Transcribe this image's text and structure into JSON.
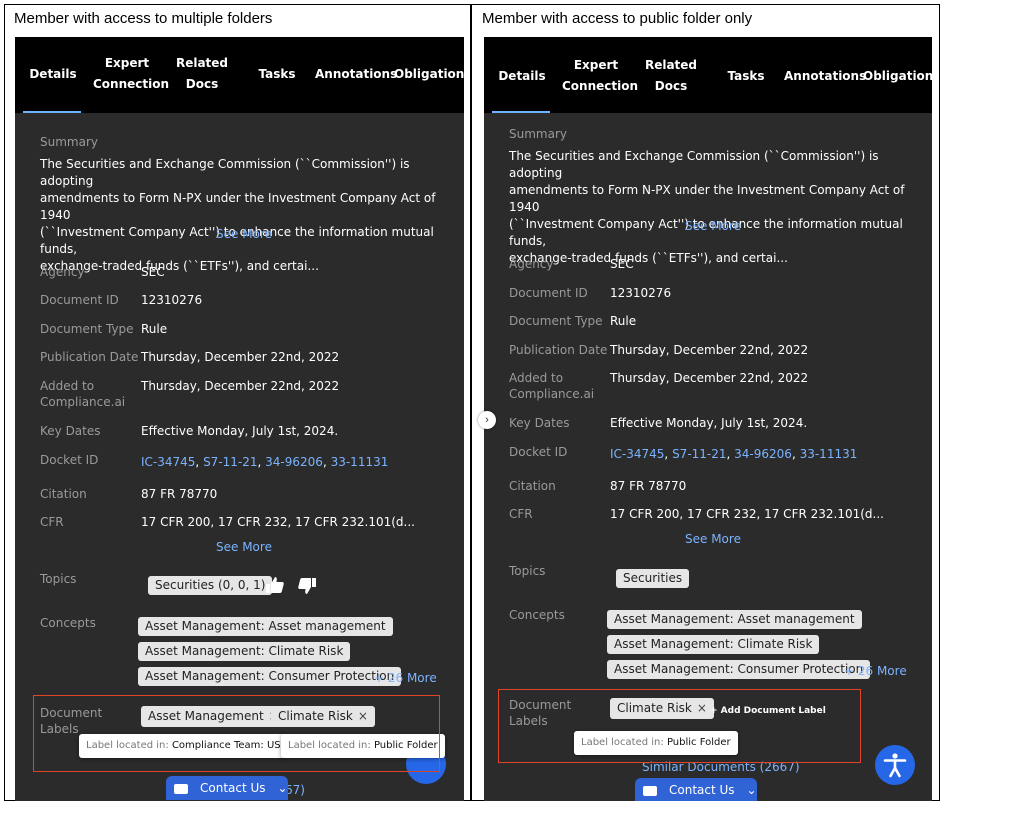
{
  "left": {
    "caption": "Member with access to multiple folders",
    "tabs": {
      "details": "Details",
      "expert_1": "Expert",
      "expert_2": "Connection",
      "related_1": "Related",
      "related_2": "Docs",
      "tasks": "Tasks",
      "annotations": "Annotations",
      "obligations": "Obligations"
    },
    "summary_label": "Summary",
    "summary_lines": [
      "The Securities and Exchange Commission (``Commission'') is adopting",
      "amendments to Form N-PX under the Investment Company Act of 1940",
      "(``Investment Company Act'') to enhance the information mutual funds,",
      "exchange-traded funds (``ETFs''), and certai..."
    ],
    "see_more_1": "See More",
    "fields": {
      "agency_label": "Agency",
      "agency": "SEC",
      "docid_label": "Document ID",
      "docid": "12310276",
      "doctype_label": "Document Type",
      "doctype": "Rule",
      "pubdate_label": "Publication Date",
      "pubdate": "Thursday, December 22nd, 2022",
      "added_label_1": "Added to",
      "added_label_2": "Compliance.ai",
      "added": "Thursday, December 22nd, 2022",
      "keydates_label": "Key Dates",
      "keydates": "Effective Monday, July 1st, 2024.",
      "docket_label": "Docket ID",
      "docket_1": "IC-34745",
      "docket_2": "S7-11-21",
      "docket_3": "34-96206",
      "docket_4": "33-11131",
      "sep": ", ",
      "citation_label": "Citation",
      "citation": "87 FR 78770",
      "cfr_label": "CFR",
      "cfr": "17 CFR 200, 17 CFR 232, 17 CFR 232.101(d..."
    },
    "see_more_2": "See More",
    "topics_label": "Topics",
    "topic_chip": "Securities (0, 0, 1)",
    "concepts_label": "Concepts",
    "concepts": [
      "Asset Management: Asset management",
      "Asset Management: Climate Risk",
      "Asset Management: Consumer Protection"
    ],
    "more_concepts": "+ 26 More",
    "doc_labels_1": "Document",
    "doc_labels_2": "Labels",
    "label_chips": [
      "Asset Management",
      "Climate Risk"
    ],
    "chip_close": "×",
    "tooltip_prefix": "Label located in:",
    "tooltip_1": "Compliance Team: US",
    "tooltip_2": "Public Folder",
    "similar_partial": "67)",
    "contact": "Contact Us"
  },
  "right": {
    "caption": "Member with access to public folder only",
    "tabs": {
      "details": "Details",
      "expert_1": "Expert",
      "expert_2": "Connection",
      "related_1": "Related",
      "related_2": "Docs",
      "tasks": "Tasks",
      "annotations": "Annotations",
      "obligations": "Obligations"
    },
    "summary_label": "Summary",
    "summary_lines": [
      "The Securities and Exchange Commission (``Commission'') is adopting",
      "amendments to Form N-PX under the Investment Company Act of 1940",
      "(``Investment Company Act'') to enhance the information mutual funds,",
      "exchange-traded funds (``ETFs''), and certai..."
    ],
    "see_more_1": "See More",
    "fields": {
      "agency_label": "Agency",
      "agency": "SEC",
      "docid_label": "Document ID",
      "docid": "12310276",
      "doctype_label": "Document Type",
      "doctype": "Rule",
      "pubdate_label": "Publication Date",
      "pubdate": "Thursday, December 22nd, 2022",
      "added_label_1": "Added to",
      "added_label_2": "Compliance.ai",
      "added": "Thursday, December 22nd, 2022",
      "keydates_label": "Key Dates",
      "keydates": "Effective Monday, July 1st, 2024.",
      "docket_label": "Docket ID",
      "docket_1": "IC-34745",
      "docket_2": "S7-11-21",
      "docket_3": "34-96206",
      "docket_4": "33-11131",
      "sep": ", ",
      "citation_label": "Citation",
      "citation": "87 FR 78770",
      "cfr_label": "CFR",
      "cfr": "17 CFR 200, 17 CFR 232, 17 CFR 232.101(d..."
    },
    "see_more_2": "See More",
    "topics_label": "Topics",
    "topic_chip": "Securities",
    "concepts_label": "Concepts",
    "concepts": [
      "Asset Management: Asset management",
      "Asset Management: Climate Risk",
      "Asset Management: Consumer Protection"
    ],
    "more_concepts": "+ 26 More",
    "doc_labels_1": "Document",
    "doc_labels_2": "Labels",
    "label_chips": [
      "Climate Risk"
    ],
    "chip_close": "×",
    "add_label": "+ Add Document Label",
    "tooltip_prefix": "Label located in:",
    "tooltip_1": "Public Folder",
    "similar": "Similar Documents (2667)",
    "contact": "Contact Us",
    "side_toggle": "›"
  },
  "colors": {
    "panel_bg": "#2b2b2b",
    "tab_bg": "#000000",
    "link": "#7bb3ff",
    "highlight_box": "#e0452a",
    "contact_bg": "#2f63d6",
    "accessibility_bg": "#2667e8"
  }
}
